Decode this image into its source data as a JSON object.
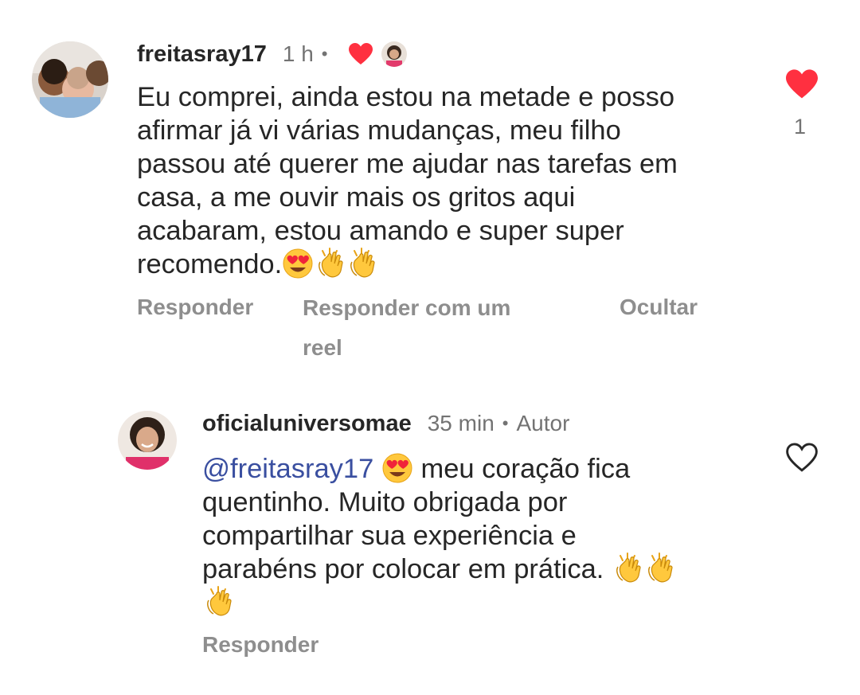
{
  "comment": {
    "username": "freitasray17",
    "time": "1 h",
    "separator": "•",
    "lines": [
      "Eu comprei, ainda estou na metade e posso",
      "afirmar já vi várias mudanças, meu filho",
      "passou até querer me ajudar nas tarefas em",
      "casa, a me ouvir mais os gritos aqui",
      "acabaram, estou amando e super super",
      "recomendo."
    ],
    "emojis_after": [
      "heart-eyes",
      "clapping-hands",
      "clapping-hands"
    ],
    "liked_by_author": true,
    "like_count": "1",
    "actions": {
      "reply": "Responder",
      "reply_reel_line1": "Responder com um",
      "reply_reel_line2": "reel",
      "hide": "Ocultar"
    }
  },
  "reply": {
    "username": "oficialuniversomae",
    "time": "35 min",
    "separator": "•",
    "badge": "Autor",
    "mention": "@freitasray17",
    "line1_rest": "meu coração fica",
    "lines": [
      "quentinho. Muito obrigada por",
      "compartilhar sua experiência e",
      "parabéns por colocar em prática."
    ],
    "actions": {
      "reply": "Responder"
    }
  },
  "colors": {
    "like_red": "#ff3040",
    "mention_blue": "#3a4fa0",
    "muted_gray": "#8e8e8e",
    "text": "#262626"
  }
}
